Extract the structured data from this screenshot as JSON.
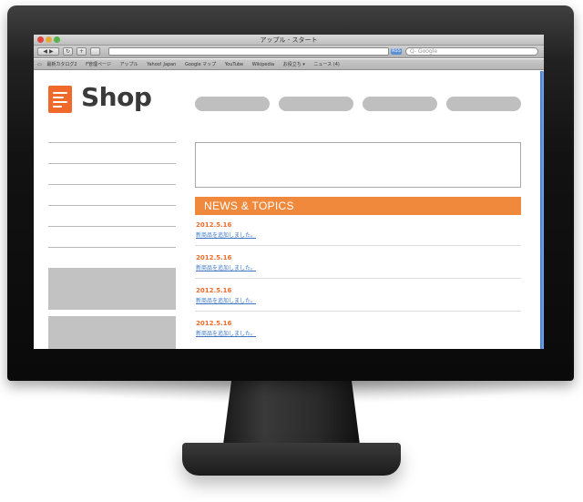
{
  "browser": {
    "window_title": "アップル - スタート",
    "back_label": "◀ ▶",
    "reload_label": "↻",
    "add_label": "+",
    "rss_label": "RSS",
    "search_placeholder": "Q- Google",
    "bookmarks": [
      "最新カタログ2",
      "F管理ページ",
      "アップル",
      "Yahoo! Japan",
      "Google マップ",
      "YouTube",
      "Wikipedia",
      "お役立ち ▾",
      "ニュース (4)"
    ]
  },
  "site": {
    "logo_text": "Shop",
    "news_header": "NEWS & TOPICS",
    "news": [
      {
        "date": "2012.5.16",
        "text": "新商品を追加しました。"
      },
      {
        "date": "2012.5.16",
        "text": "新商品を追加しました。"
      },
      {
        "date": "2012.5.16",
        "text": "新商品を追加しました。"
      },
      {
        "date": "2012.5.16",
        "text": "新商品を追加しました。"
      }
    ]
  },
  "colors": {
    "accent": "#f0893c",
    "logo": "#ef6a2a",
    "link": "#3b77c6",
    "placeholder_gray": "#bfbfbf"
  }
}
